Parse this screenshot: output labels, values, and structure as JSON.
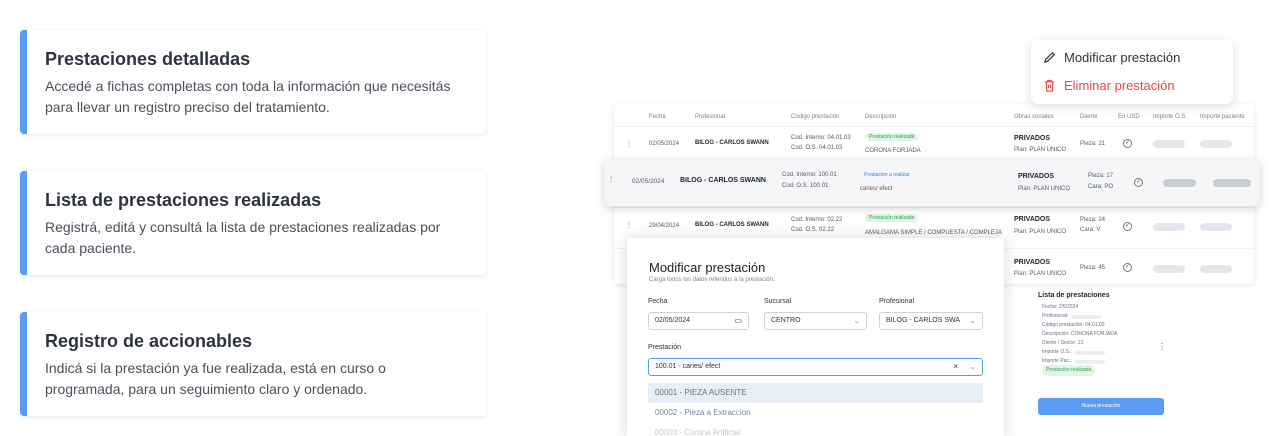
{
  "features": [
    {
      "title": "Prestaciones detalladas",
      "desc": "Accedé a fichas completas con toda la información que necesitás para llevar un registro preciso del tratamiento."
    },
    {
      "title": "Lista de prestaciones realizadas",
      "desc": "Registrá, editá y consultá la lista de prestaciones realizadas por cada paciente."
    },
    {
      "title": "Registro de accionables",
      "desc": "Indicá si la prestación ya fue realizada, está en curso o programada, para un seguimiento claro y ordenado."
    }
  ],
  "menu": {
    "edit": "Modificar prestación",
    "delete": "Eliminar prestación",
    "edit_icon": "pencil-icon",
    "delete_icon": "trash-icon",
    "delete_color": "#e04848"
  },
  "table": {
    "headers": [
      "Fecha",
      "Profesional",
      "Código prestación",
      "Descripción",
      "Obras sociales",
      "Diente",
      "En USD",
      "Importe O.S.",
      "Importe paciente"
    ],
    "rows": [
      {
        "fecha": "02/05/2024",
        "prof": "BILOG - CARLOS SWANN",
        "cod1": "Cod. Interno: 04.01.03",
        "cod2": "Cod. O.S. 04.01.03",
        "badge": "Prestación realizada",
        "desc": "CORONA FORJADA",
        "os": "PRIVADOS",
        "plan": "Plan: PLAN UNICO",
        "diente1": "Pieza: 21",
        "diente2": ""
      },
      {
        "fecha": "02/05/2024",
        "prof": "BILOG - CARLOS SWANN",
        "cod1": "Cod. Interno: 100.01",
        "cod2": "Cod. O.S. 100.01",
        "badge": "Prestación a realizar",
        "desc": "caries/ efect",
        "os": "PRIVADOS",
        "plan": "Plan: PLAN UNICO",
        "diente1": "Pieza: 17",
        "diente2": "Cara: PO"
      },
      {
        "fecha": "29/04/2024",
        "prof": "BILOG - CARLOS SWANN",
        "cod1": "Cod. Interno: 02.22",
        "cod2": "Cod. O.S. 02.22",
        "badge": "Prestación realizada",
        "desc": "AMALGAMA SIMPLE / COMPUESTA / COMPLEJA",
        "os": "PRIVADOS",
        "plan": "Plan: PLAN UNICO",
        "diente1": "Pieza: 24",
        "diente2": "Cara: V"
      },
      {
        "fecha": "",
        "prof": "",
        "cod1": "",
        "cod2": "",
        "badge": "",
        "desc": "",
        "os": "PRIVADOS",
        "plan": "Plan: PLAN UNICO",
        "diente1": "Pieza: 45",
        "diente2": ""
      }
    ]
  },
  "modal": {
    "title": "Modificar prestación",
    "subtitle": "Cargá todos los datos referidos a la prestación.",
    "fecha_label": "Fecha",
    "fecha_value": "02/05/2024",
    "sucursal_label": "Sucursal",
    "sucursal_value": "CENTRO",
    "profesional_label": "Profesional",
    "profesional_value": "BILOG - CARLOS SWA",
    "prestacion_label": "Prestación",
    "prestacion_value": "100.01 - caries/ efect",
    "options": [
      "00001 - PIEZA AUSENTE",
      "00002 - Pieza a Extraccion",
      "00003 - Corona Artificial"
    ]
  },
  "summary": {
    "title": "Lista de prestaciones",
    "lines": [
      "Fecha: 2/5/2024",
      "Profesional:",
      "Código prestación: 04.01.03",
      "Descripción: CORONA FORJADA",
      "Diente / Sector: 21",
      "Importe O.S.:",
      "Importe Pac.:"
    ],
    "badge": "Prestación realizada",
    "button": "Nueva prestación"
  }
}
